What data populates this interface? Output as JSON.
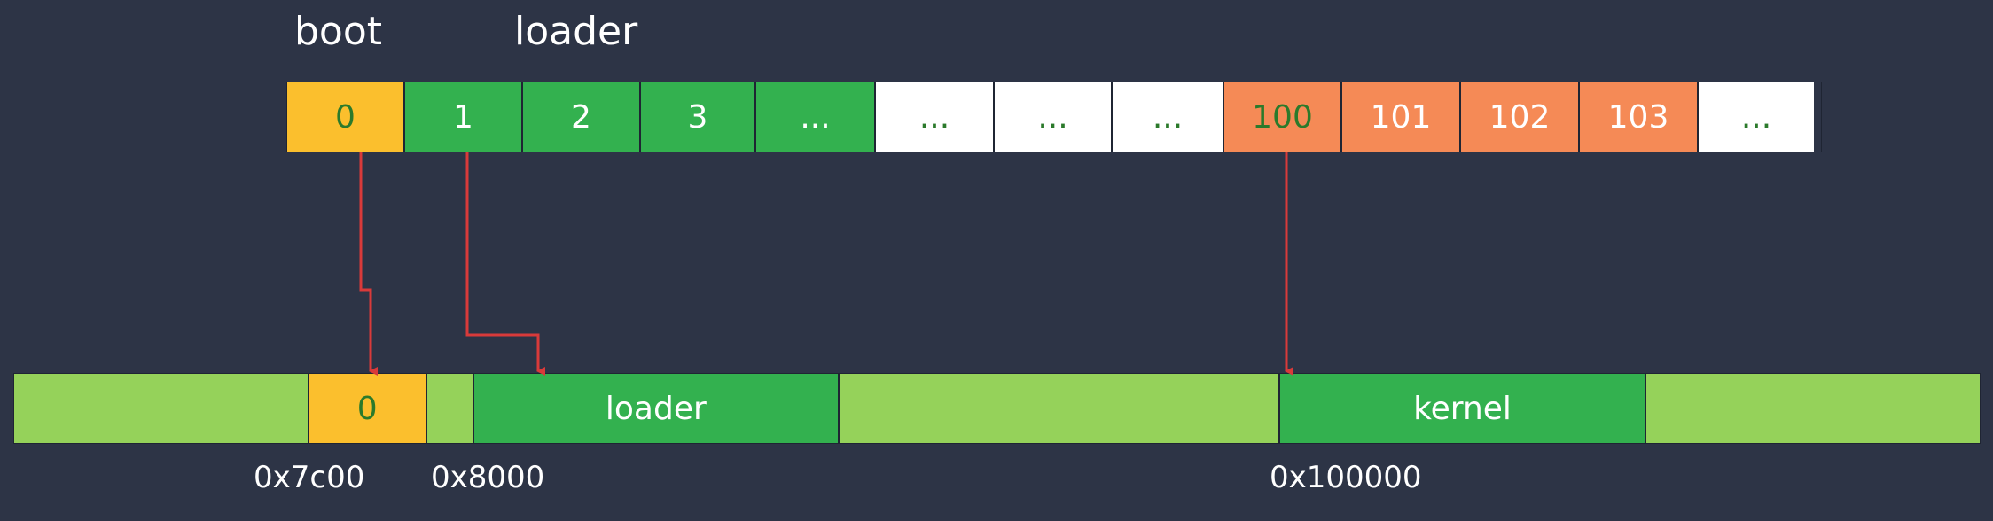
{
  "top_labels": {
    "boot": "boot",
    "loader": "loader"
  },
  "colors": {
    "background": "#2d3446",
    "boot_yellow": "#fbbf2d",
    "loader_green": "#33b14f",
    "memory_light_green": "#95d25a",
    "kernel_orange": "#f58a56",
    "empty_white": "#ffffff",
    "arrow_red": "#d93a3a",
    "text_green": "#2b7a2b"
  },
  "disk_sectors": [
    {
      "label": "0",
      "color": "boot_yellow",
      "text_color": "text_green"
    },
    {
      "label": "1",
      "color": "loader_green",
      "text_color": "empty_white"
    },
    {
      "label": "2",
      "color": "loader_green",
      "text_color": "empty_white"
    },
    {
      "label": "3",
      "color": "loader_green",
      "text_color": "empty_white"
    },
    {
      "label": "...",
      "color": "loader_green",
      "text_color": "empty_white"
    },
    {
      "label": "...",
      "color": "empty_white",
      "text_color": "text_green"
    },
    {
      "label": "...",
      "color": "empty_white",
      "text_color": "text_green"
    },
    {
      "label": "...",
      "color": "empty_white",
      "text_color": "text_green"
    },
    {
      "label": "100",
      "color": "kernel_orange",
      "text_color": "text_green"
    },
    {
      "label": "101",
      "color": "kernel_orange",
      "text_color": "empty_white"
    },
    {
      "label": "102",
      "color": "kernel_orange",
      "text_color": "empty_white"
    },
    {
      "label": "103",
      "color": "kernel_orange",
      "text_color": "empty_white"
    },
    {
      "label": "...",
      "color": "empty_white",
      "text_color": "text_green"
    }
  ],
  "memory_regions": [
    {
      "label": "",
      "color": "memory_light_green",
      "text_color": "empty_white"
    },
    {
      "label": "0",
      "color": "boot_yellow",
      "text_color": "text_green"
    },
    {
      "label": "",
      "color": "memory_light_green",
      "text_color": "empty_white"
    },
    {
      "label": "loader",
      "color": "loader_green",
      "text_color": "empty_white"
    },
    {
      "label": "",
      "color": "memory_light_green",
      "text_color": "empty_white"
    },
    {
      "label": "kernel",
      "color": "loader_green",
      "text_color": "empty_white"
    },
    {
      "label": "",
      "color": "memory_light_green",
      "text_color": "empty_white"
    }
  ],
  "addresses": {
    "boot_addr": "0x7c00",
    "loader_addr": "0x8000",
    "kernel_addr": "0x100000"
  }
}
